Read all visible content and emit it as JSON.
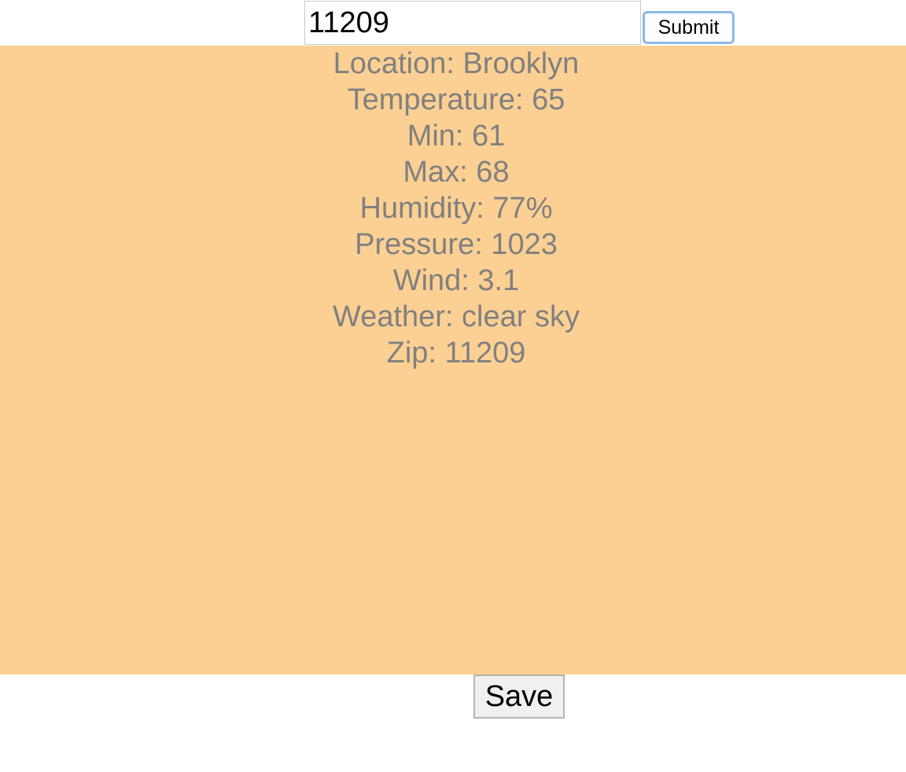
{
  "search": {
    "zip_value": "11209",
    "submit_label": "Submit"
  },
  "weather": {
    "lines": [
      "Location: Brooklyn",
      "Temperature: 65",
      "Min: 61",
      "Max: 68",
      "Humidity: 77%",
      "Pressure: 1023",
      "Wind: 3.1",
      "Weather: clear sky",
      "Zip: 11209"
    ]
  },
  "actions": {
    "save_label": "Save"
  },
  "colors": {
    "panel_background": "#fcd093",
    "panel_text": "#808080",
    "submit_focus_ring": "#8db9e8"
  }
}
